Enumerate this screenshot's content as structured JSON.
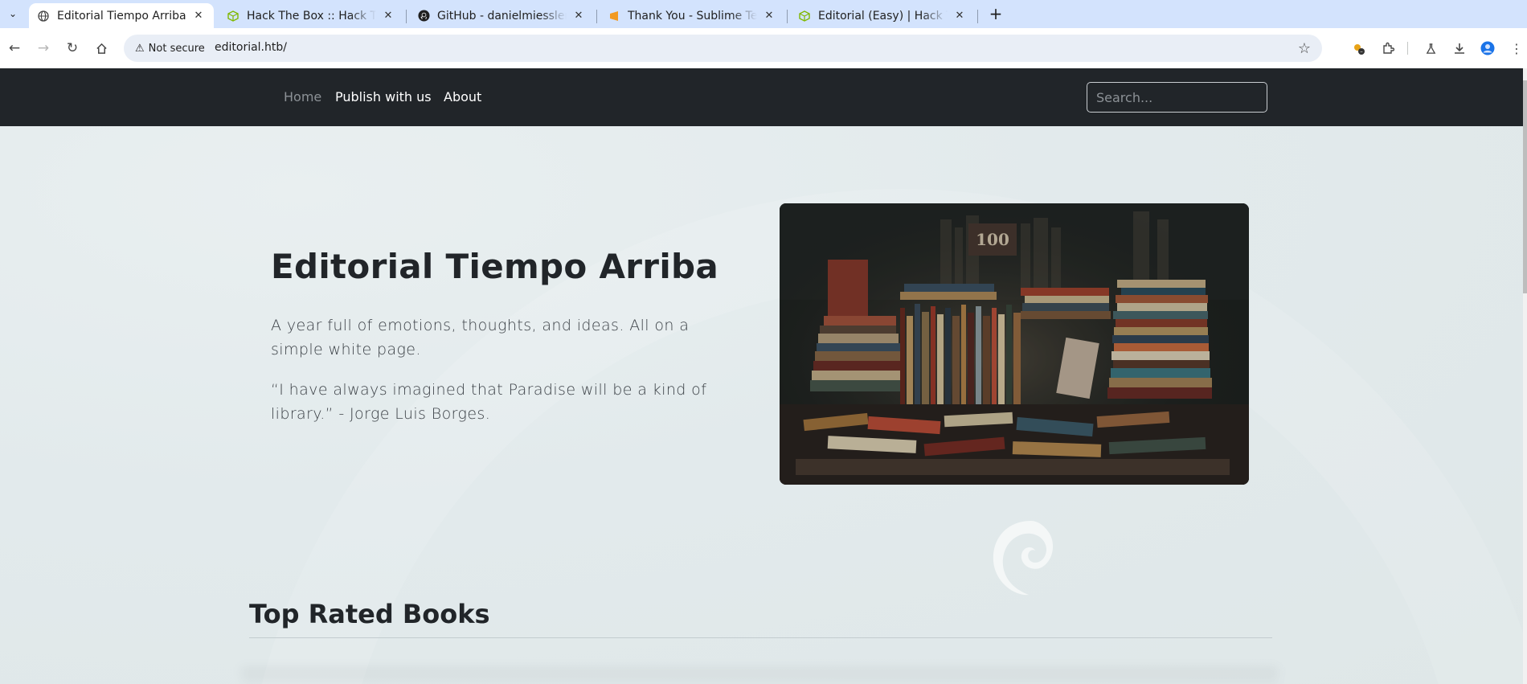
{
  "browser": {
    "tabs": [
      {
        "title": "Editorial Tiempo Arriba",
        "favicon": "globe-icon",
        "active": true
      },
      {
        "title": "Hack The Box :: Hack The",
        "favicon": "htb-cube-icon",
        "active": false
      },
      {
        "title": "GitHub - danielmiessler/S",
        "favicon": "github-icon",
        "active": false
      },
      {
        "title": "Thank You - Sublime Text",
        "favicon": "sublime-icon",
        "active": false
      },
      {
        "title": "Editorial (Easy) | Hack Th",
        "favicon": "htb-cube-icon",
        "active": false
      }
    ],
    "security_label": "Not secure",
    "url": "editorial.htb/"
  },
  "site": {
    "nav": {
      "home": "Home",
      "publish": "Publish with us",
      "about": "About",
      "search_placeholder": "Search..."
    },
    "hero": {
      "title": "Editorial Tiempo Arriba",
      "line1": "A year full of emotions, thoughts, and ideas. All on a simple white page.",
      "quote": "“I have always imagined that Paradise will be a kind of library.” - Jorge Luis Borges."
    },
    "section_title": "Top Rated Books"
  },
  "colors": {
    "navbar": "#212529",
    "tabbar": "#d3e3fd",
    "page_bg": "#e2eaec"
  }
}
